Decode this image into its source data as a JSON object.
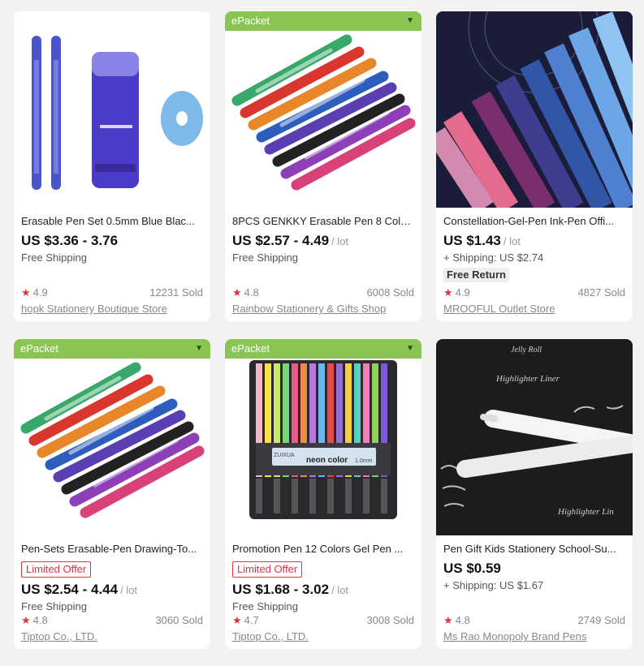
{
  "colors": {
    "epacket": "#8ac554",
    "star": "#e0333f",
    "badge": "#e0333f"
  },
  "products": [
    {
      "epacket": "",
      "title": "Erasable Pen Set 0.5mm Blue Blac...",
      "badge": "",
      "price": "US $3.36 - 3.76",
      "unit": "",
      "shipping": "Free Shipping",
      "return": "",
      "rating": "4.9",
      "sold": "12231 Sold",
      "store": "hopk Stationery Boutique Store"
    },
    {
      "epacket": "ePacket",
      "title": "8PCS GENKKY Erasable Pen 8 Colo...",
      "badge": "",
      "price": "US $2.57 - 4.49",
      "unit": "/ lot",
      "shipping": "Free Shipping",
      "return": "",
      "rating": "4.8",
      "sold": "6008 Sold",
      "store": "Rainbow Stationery & Gifts Shop"
    },
    {
      "epacket": "",
      "title": "Constellation-Gel-Pen Ink-Pen Offi...",
      "badge": "",
      "price": "US $1.43",
      "unit": "/ lot",
      "shipping": "+ Shipping: US $2.74",
      "return": "Free Return",
      "rating": "4.9",
      "sold": "4827 Sold",
      "store": "MROOFUL Outlet Store"
    },
    {
      "epacket": "ePacket",
      "title": "Pen-Sets Erasable-Pen Drawing-To...",
      "badge": "Limited Offer",
      "price": "US $2.54 - 4.44",
      "unit": "/ lot",
      "shipping": "Free Shipping",
      "return": "",
      "rating": "4.8",
      "sold": "3060 Sold",
      "store": "Tiptop Co., LTD."
    },
    {
      "epacket": "ePacket",
      "title": "Promotion Pen 12 Colors Gel Pen ...",
      "badge": "Limited Offer",
      "price": "US $1.68 - 3.02",
      "unit": "/ lot",
      "shipping": "Free Shipping",
      "return": "",
      "rating": "4.7",
      "sold": "3008 Sold",
      "store": "Tiptop Co., LTD."
    },
    {
      "epacket": "",
      "title": "Pen Gift Kids Stationery School-Su...",
      "badge": "",
      "price": "US $0.59",
      "unit": "",
      "shipping": "+ Shipping: US $1.67",
      "return": "",
      "rating": "4.8",
      "sold": "2749 Sold",
      "store": "Ms Rao Monopoly Brand Pens"
    }
  ],
  "images": {
    "p5_box_brand": "ZUIXUA",
    "p5_box_label": "neon color",
    "p5_box_size": "1.0mm",
    "p6_words": [
      "Jelly Roll",
      "Highlighter Liner",
      "Highlighter Lin"
    ]
  }
}
